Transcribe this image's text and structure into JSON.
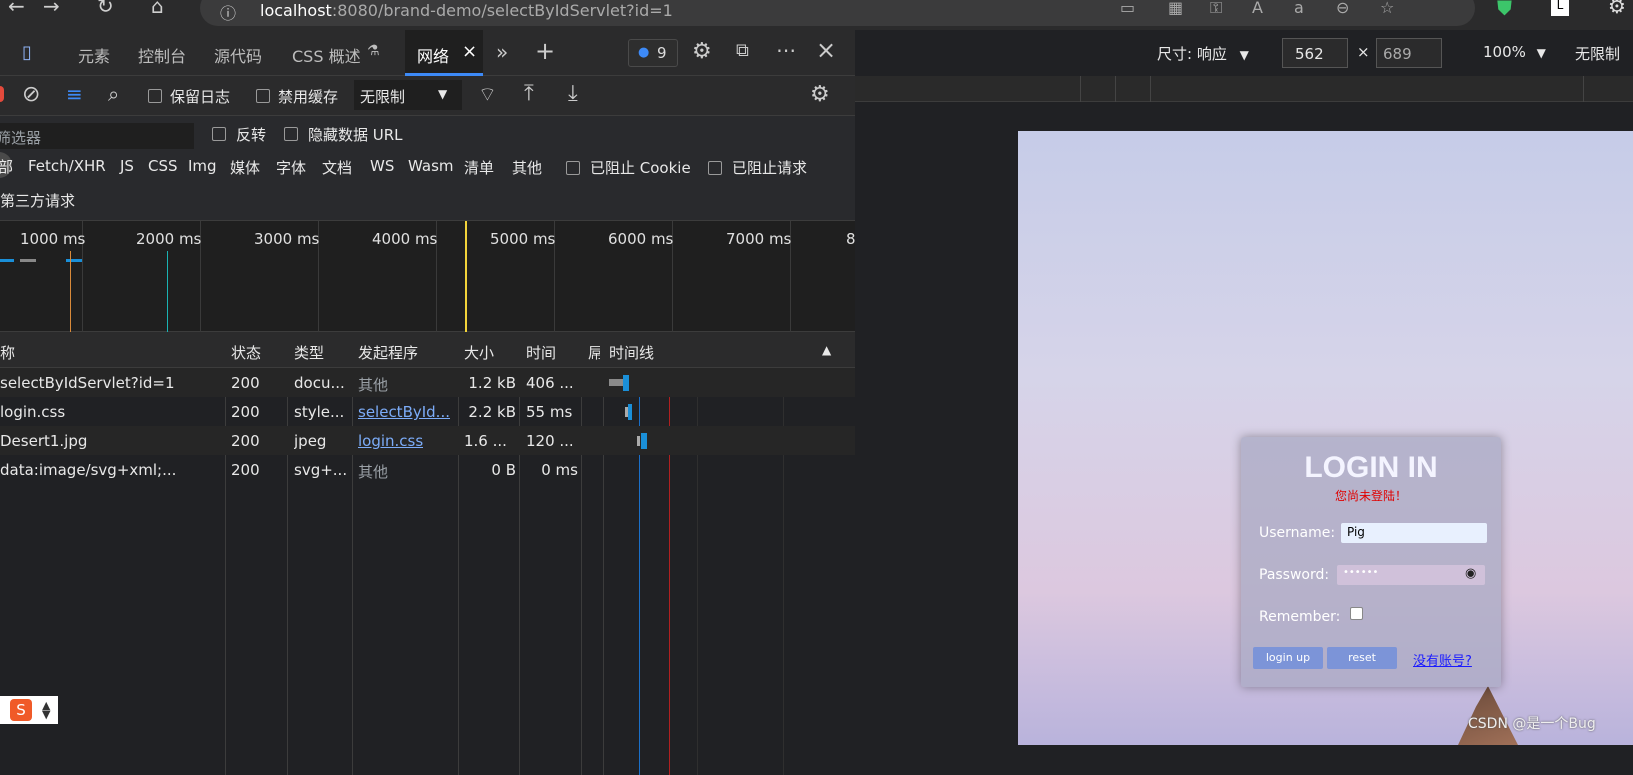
{
  "browser": {
    "url_host": "localhost",
    "url_rest": ":8080/brand-demo/selectByIdServlet?id=1"
  },
  "devtools": {
    "tabs": [
      "元素",
      "控制台",
      "源代码",
      "CSS 概述",
      "网络"
    ],
    "issues_count": "9",
    "toolbar": {
      "preserve_log": "保留日志",
      "disable_cache": "禁用缓存",
      "throttling": "无限制"
    },
    "filter": {
      "placeholder": "筛选器",
      "invert": "反转",
      "hide_data_urls": "隐藏数据 URL",
      "third_party": "第三方请求",
      "blocked_cookies": "已阻止 Cookie",
      "blocked_requests": "已阻止请求",
      "types": [
        "部",
        "Fetch/XHR",
        "JS",
        "CSS",
        "Img",
        "媒体",
        "字体",
        "文档",
        "WS",
        "Wasm",
        "清单",
        "其他"
      ]
    },
    "overview_ticks": [
      "1000 ms",
      "2000 ms",
      "3000 ms",
      "4000 ms",
      "5000 ms",
      "6000 ms",
      "7000 ms",
      "8"
    ],
    "columns": {
      "name": "称",
      "status": "状态",
      "type": "类型",
      "initiator": "发起程序",
      "size": "大小",
      "time": "时间",
      "priority": "屌",
      "waterfall": "时间线"
    },
    "requests": [
      {
        "name": "selectByIdServlet?id=1",
        "status": "200",
        "type": "docu...",
        "initiator": "其他",
        "initiator_link": false,
        "size": "1.2 kB",
        "time": "406 ..."
      },
      {
        "name": "login.css",
        "status": "200",
        "type": "style...",
        "initiator": "selectById...",
        "initiator_link": true,
        "size": "2.2 kB",
        "time": "55 ms"
      },
      {
        "name": "Desert1.jpg",
        "status": "200",
        "type": "jpeg",
        "initiator": "login.css",
        "initiator_link": true,
        "size": "1.6 ...",
        "time": "120 ..."
      },
      {
        "name": "data:image/svg+xml;...",
        "status": "200",
        "type": "svg+...",
        "initiator": "其他",
        "initiator_link": false,
        "size": "0 B",
        "time": "0 ms"
      }
    ]
  },
  "device": {
    "dimensions_label": "尺寸: 响应",
    "width": "562",
    "height": "689",
    "times": "×",
    "zoom": "100%",
    "throttle": "无限制"
  },
  "login": {
    "title": "LOGIN IN",
    "error": "您尚未登陆！",
    "username_label": "Username:",
    "username_value": "Pig",
    "password_label": "Password:",
    "password_value": "••••••",
    "remember_label": "Remember:",
    "login_button": "login up",
    "reset_button": "reset",
    "register_link": "没有账号?"
  },
  "watermark": "CSDN @是一个Bug",
  "colors": {
    "accent": "#3d8af7",
    "link": "#7cacf8",
    "error": "#e00000"
  }
}
